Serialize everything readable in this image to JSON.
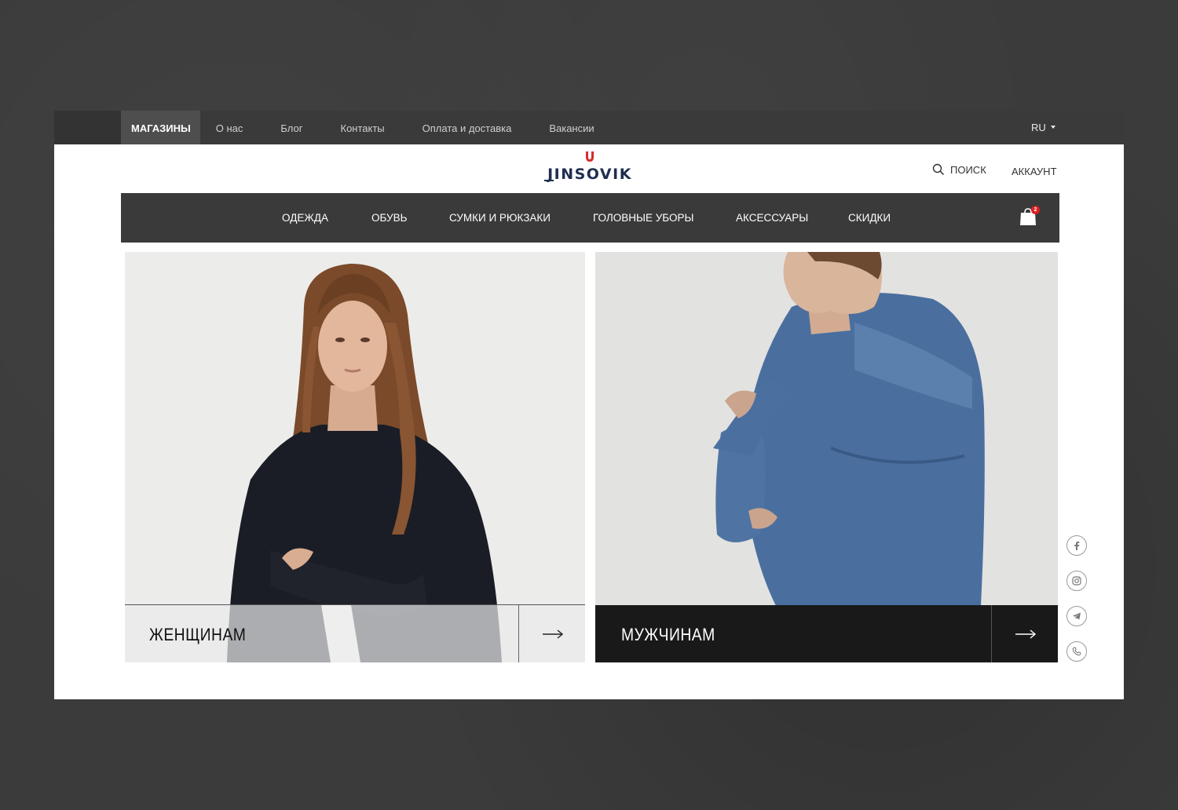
{
  "topbar": {
    "links": [
      "МАГАЗИНЫ",
      "О нас",
      "Блог",
      "Контакты",
      "Оплата и доставка",
      "Вакансии"
    ],
    "language": "RU"
  },
  "header": {
    "logo_text": "JINSOVIK",
    "search_label": "ПОИСК",
    "account_label": "АККАУНТ"
  },
  "nav": {
    "items": [
      "ОДЕЖДА",
      "ОБУВЬ",
      "СУМКИ И РЮКЗАКИ",
      "ГОЛОВНЫЕ УБОРЫ",
      "АКСЕССУАРЫ",
      "СКИДКИ"
    ],
    "cart_count": "2"
  },
  "categories": {
    "women": "ЖЕНЩИНАМ",
    "men": "МУЖЧИНАМ"
  },
  "social": [
    "facebook-icon",
    "instagram-icon",
    "telegram-icon",
    "phone-icon"
  ],
  "colors": {
    "brand_navy": "#1f2e4f",
    "brand_red": "#d62c2c",
    "nav_dark": "#3a3a3a"
  }
}
